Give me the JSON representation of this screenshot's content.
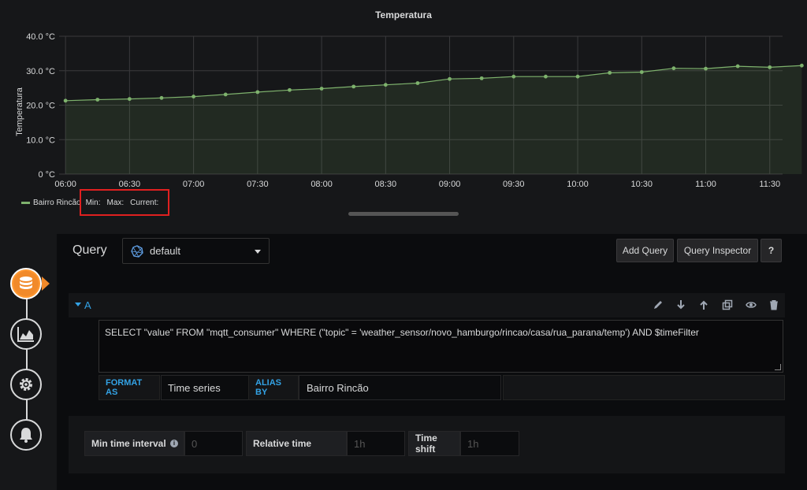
{
  "panel": {
    "title": "Temperatura"
  },
  "chart_data": {
    "type": "area",
    "title": "Temperatura",
    "ylabel": "Temperatura",
    "xlabel": "",
    "ylim": [
      0,
      40
    ],
    "y_ticks": [
      "0 °C",
      "10.0 °C",
      "20.0 °C",
      "30.0 °C",
      "40.0 °C"
    ],
    "x_ticks": [
      "06:00",
      "06:30",
      "07:00",
      "07:30",
      "08:00",
      "08:30",
      "09:00",
      "09:30",
      "10:00",
      "10:30",
      "11:00",
      "11:30"
    ],
    "x_range": [
      "05:57",
      "11:36"
    ],
    "grid": true,
    "legend": "bottom-left",
    "series": [
      {
        "name": "Bairro Rincão",
        "color": "#7eb26d",
        "x": [
          "06:00",
          "06:15",
          "06:30",
          "06:45",
          "07:00",
          "07:15",
          "07:30",
          "07:45",
          "08:00",
          "08:15",
          "08:30",
          "08:45",
          "09:00",
          "09:15",
          "09:30",
          "09:45",
          "10:00",
          "10:15",
          "10:30",
          "10:45",
          "11:00",
          "11:15",
          "11:30",
          "11:45"
        ],
        "values": [
          21.3,
          21.6,
          21.8,
          22.1,
          22.5,
          23.1,
          23.8,
          24.4,
          24.8,
          25.4,
          25.9,
          26.4,
          27.6,
          27.8,
          28.3,
          28.3,
          28.3,
          29.4,
          29.6,
          30.7,
          30.6,
          31.3,
          31.0,
          31.5
        ]
      }
    ]
  },
  "legend": {
    "series_name": "Bairro Rincão",
    "min_label": "Min:",
    "max_label": "Max:",
    "current_label": "Current:"
  },
  "sidebar": {
    "items": [
      {
        "name": "queries",
        "icon": "database-icon",
        "active": true
      },
      {
        "name": "visualization",
        "icon": "chart-icon",
        "active": false
      },
      {
        "name": "general",
        "icon": "gear-icon",
        "active": false
      },
      {
        "name": "alert",
        "icon": "bell-icon",
        "active": false
      }
    ]
  },
  "query_header": {
    "title": "Query",
    "datasource": "default",
    "add_query_label": "Add Query",
    "inspector_label": "Query Inspector",
    "help_label": "?"
  },
  "query_a": {
    "ref_id": "A",
    "text": "SELECT \"value\" FROM \"mqtt_consumer\" WHERE (\"topic\" = 'weather_sensor/novo_hamburgo/rincao/casa/rua_parana/temp') AND $timeFilter",
    "format_as_label": "FORMAT AS",
    "format_as_value": "Time series",
    "alias_by_label": "ALIAS BY",
    "alias_by_value": "Bairro Rincão"
  },
  "options": {
    "min_interval_label": "Min time interval",
    "min_interval_placeholder": "0",
    "relative_time_label": "Relative time",
    "relative_time_placeholder": "1h",
    "time_shift_label": "Time shift",
    "time_shift_placeholder": "1h"
  },
  "colors": {
    "accent_orange": "#f18a2a",
    "link_blue": "#33a2e5",
    "series_green": "#7eb26d",
    "highlight_red": "#e02020"
  }
}
